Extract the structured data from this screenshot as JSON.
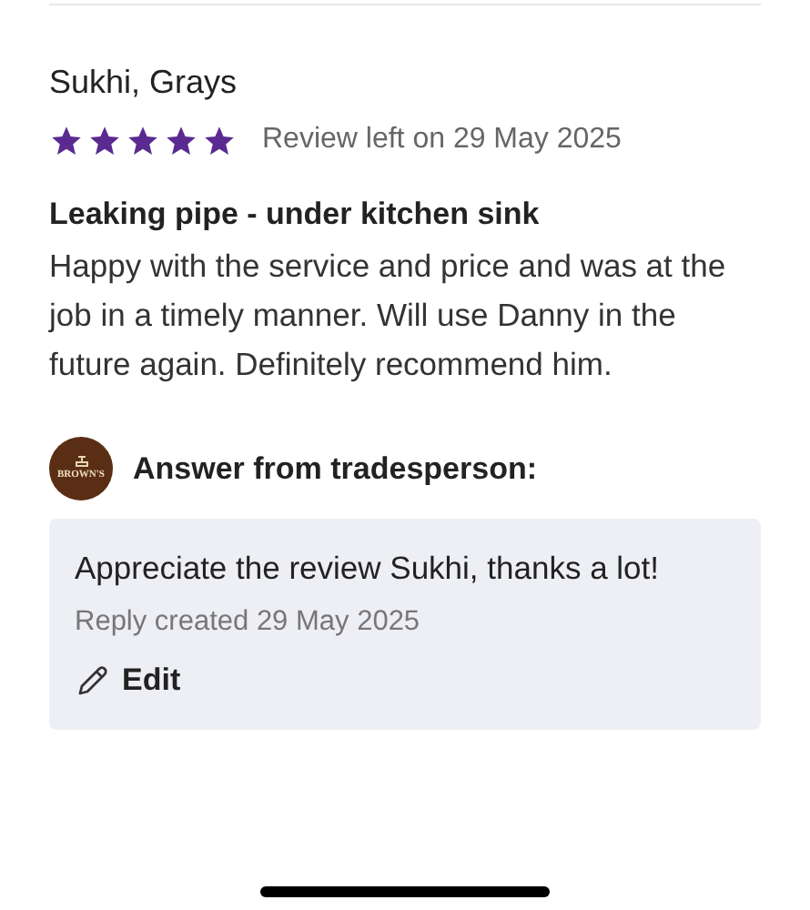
{
  "review": {
    "reviewer": "Sukhi, Grays",
    "stars": 5,
    "date_text": "Review left on 29 May 2025",
    "title": "Leaking pipe - under kitchen sink",
    "body": "Happy with the service and price and was at the job in a timely manner. Will use Danny in the future again. Definitely recommend him."
  },
  "answer": {
    "logo_text": "BROWN'S",
    "heading": "Answer from tradesperson:",
    "text": "Appreciate the review Sukhi, thanks a lot!",
    "date_text": "Reply created 29 May 2025",
    "edit_label": "Edit"
  }
}
